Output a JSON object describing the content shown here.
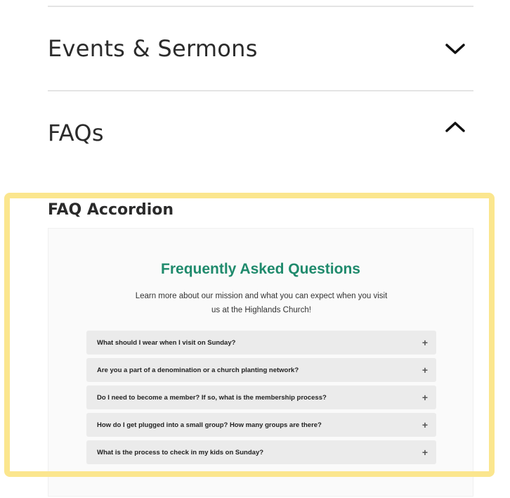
{
  "accordion": {
    "items": [
      {
        "title": "Events & Sermons",
        "state": "collapsed",
        "icon": "chevron-down-icon"
      },
      {
        "title": "FAQs",
        "state": "expanded",
        "icon": "chevron-up-icon"
      }
    ]
  },
  "section": {
    "label": "FAQ Accordion"
  },
  "preview": {
    "heading": "Frequently Asked Questions",
    "intro_line1": "Learn more about our mission and what you can expect when you visit",
    "intro_line2": "us at the Highlands Church!",
    "questions": [
      "What should I wear when I visit on Sunday?",
      "Are you a part of a denomination or a church planting network?",
      "Do I need to become a member? If so, what is the membership process?",
      "How do I get plugged into a small group? How many groups are there?",
      "What is the process to check in my kids on Sunday?"
    ],
    "expand_symbol": "+"
  },
  "colors": {
    "heading_green": "#1f8a6c",
    "highlight_yellow": "#fbe68e",
    "question_bg": "#ebebeb"
  }
}
